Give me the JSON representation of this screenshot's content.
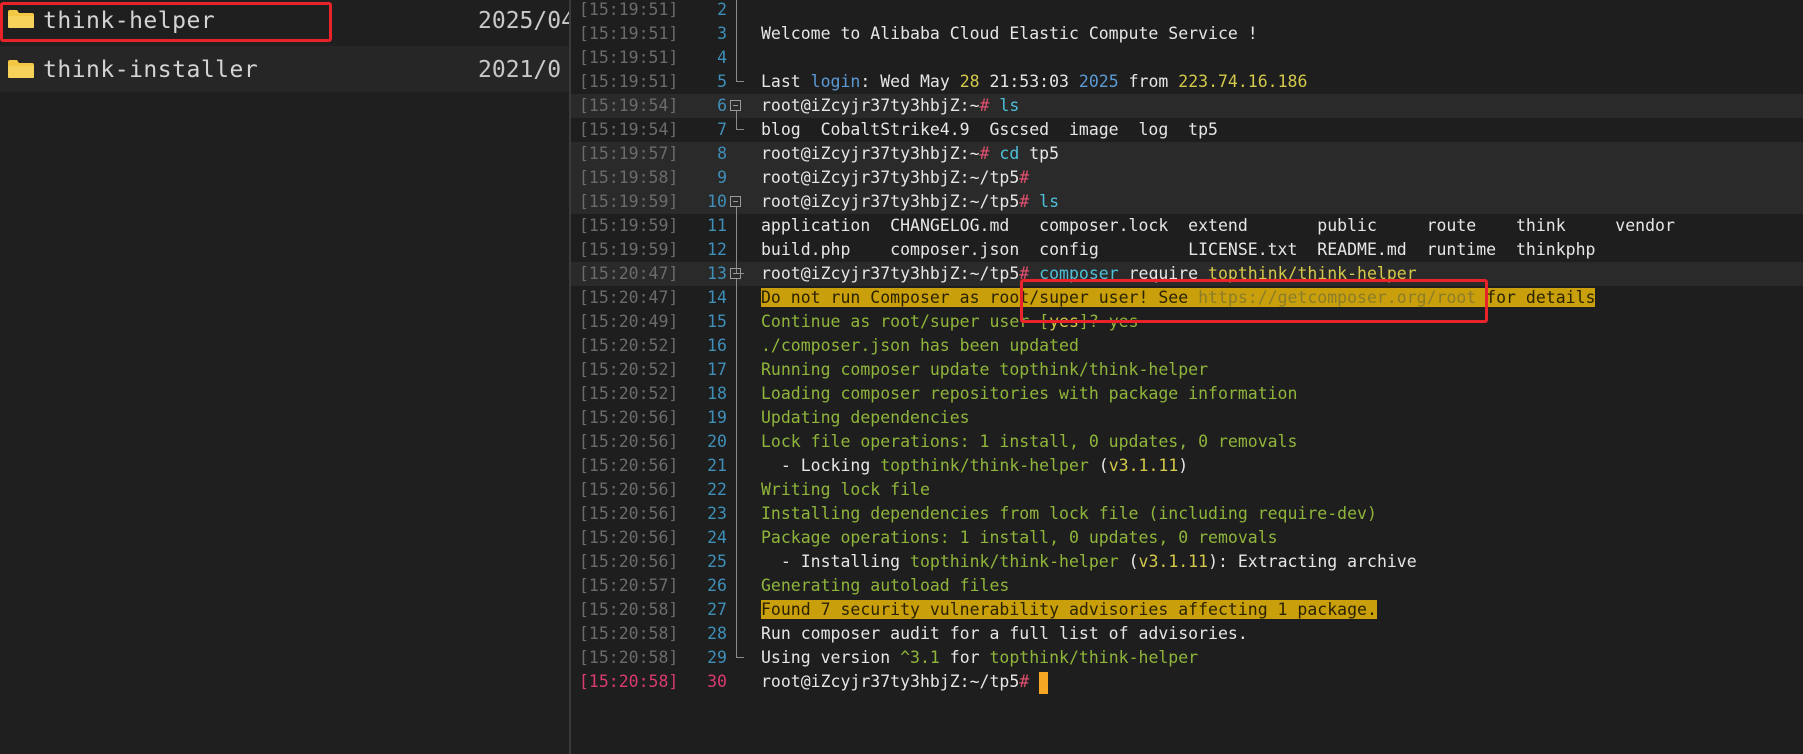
{
  "files": [
    {
      "name": "think-helper",
      "date": "2025/04"
    },
    {
      "name": "think-installer",
      "date": "2021/0"
    }
  ],
  "terminal": {
    "lines": [
      {
        "ts": "[15:19:51]",
        "ln": "2",
        "segs": []
      },
      {
        "ts": "[15:19:51]",
        "ln": "3",
        "segs": [
          {
            "t": "Welcome to Alibaba Cloud Elastic Compute Service !",
            "c": "w"
          }
        ]
      },
      {
        "ts": "[15:19:51]",
        "ln": "4",
        "segs": []
      },
      {
        "ts": "[15:19:51]",
        "ln": "5",
        "segs": [
          {
            "t": "Last ",
            "c": "w"
          },
          {
            "t": "login",
            "c": "b"
          },
          {
            "t": ": Wed May ",
            "c": "w"
          },
          {
            "t": "28",
            "c": "y"
          },
          {
            "t": " 21:53:03 ",
            "c": "w"
          },
          {
            "t": "2025",
            "c": "b"
          },
          {
            "t": " from ",
            "c": "w"
          },
          {
            "t": "223.74.16.186",
            "c": "y"
          }
        ]
      },
      {
        "ts": "[15:19:54]",
        "ln": "6",
        "segs": [
          {
            "t": "root@iZcyjr37ty3hbjZ:~",
            "c": "w"
          },
          {
            "t": "# ",
            "c": "r"
          },
          {
            "t": "ls",
            "c": "c"
          }
        ]
      },
      {
        "ts": "[15:19:54]",
        "ln": "7",
        "segs": [
          {
            "t": "blog  CobaltStrike4.9  Gscsed  image  log  tp5",
            "c": "w"
          }
        ]
      },
      {
        "ts": "[15:19:57]",
        "ln": "8",
        "segs": [
          {
            "t": "root@iZcyjr37ty3hbjZ:~",
            "c": "w"
          },
          {
            "t": "# ",
            "c": "r"
          },
          {
            "t": "cd",
            "c": "c"
          },
          {
            "t": " tp5",
            "c": "w"
          }
        ]
      },
      {
        "ts": "[15:19:58]",
        "ln": "9",
        "segs": [
          {
            "t": "root@iZcyjr37ty3hbjZ:~/tp5",
            "c": "w"
          },
          {
            "t": "#",
            "c": "r"
          }
        ]
      },
      {
        "ts": "[15:19:59]",
        "ln": "10",
        "segs": [
          {
            "t": "root@iZcyjr37ty3hbjZ:~/tp5",
            "c": "w"
          },
          {
            "t": "# ",
            "c": "r"
          },
          {
            "t": "ls",
            "c": "c"
          }
        ]
      },
      {
        "ts": "[15:19:59]",
        "ln": "11",
        "segs": [
          {
            "t": "application  CHANGELOG.md   composer.lock  extend       public     route    think     vendor",
            "c": "w"
          }
        ]
      },
      {
        "ts": "[15:19:59]",
        "ln": "12",
        "segs": [
          {
            "t": "build.php    composer.json  config         LICENSE.txt  README.md  runtime  thinkphp",
            "c": "w"
          }
        ]
      },
      {
        "ts": "[15:20:47]",
        "ln": "13",
        "segs": [
          {
            "t": "root@iZcyjr37ty3hbjZ:~/tp5",
            "c": "w"
          },
          {
            "t": "# ",
            "c": "r"
          },
          {
            "t": "composer",
            "c": "c"
          },
          {
            "t": " require ",
            "c": "w"
          },
          {
            "t": "topthink/think-helper",
            "c": "y"
          }
        ]
      },
      {
        "ts": "[15:20:47]",
        "ln": "14",
        "segs": [
          {
            "t": "Do not run Composer as root/super user! See ",
            "c": "warn"
          },
          {
            "t": "https://getcomposer.org/root",
            "c": "warndim"
          },
          {
            "t": " for details",
            "c": "warn"
          }
        ]
      },
      {
        "ts": "[15:20:49]",
        "ln": "15",
        "segs": [
          {
            "t": "Continue as root/super user [",
            "c": "g"
          },
          {
            "t": "yes",
            "c": "y"
          },
          {
            "t": "]? ",
            "c": "g"
          },
          {
            "t": "yes",
            "c": "g"
          }
        ]
      },
      {
        "ts": "[15:20:52]",
        "ln": "16",
        "segs": [
          {
            "t": "./composer.json has been updated",
            "c": "g"
          }
        ]
      },
      {
        "ts": "[15:20:52]",
        "ln": "17",
        "segs": [
          {
            "t": "Running composer update topthink/think-helper",
            "c": "g"
          }
        ]
      },
      {
        "ts": "[15:20:52]",
        "ln": "18",
        "segs": [
          {
            "t": "Loading composer repositories with package information",
            "c": "g"
          }
        ]
      },
      {
        "ts": "[15:20:56]",
        "ln": "19",
        "segs": [
          {
            "t": "Updating dependencies",
            "c": "g"
          }
        ]
      },
      {
        "ts": "[15:20:56]",
        "ln": "20",
        "segs": [
          {
            "t": "Lock file operations: 1 install, 0 updates, 0 removals",
            "c": "g"
          }
        ]
      },
      {
        "ts": "[15:20:56]",
        "ln": "21",
        "segs": [
          {
            "t": "  - Locking ",
            "c": "w"
          },
          {
            "t": "topthink/think-helper",
            "c": "g"
          },
          {
            "t": " (",
            "c": "w"
          },
          {
            "t": "v3.1.11",
            "c": "y"
          },
          {
            "t": ")",
            "c": "w"
          }
        ]
      },
      {
        "ts": "[15:20:56]",
        "ln": "22",
        "segs": [
          {
            "t": "Writing lock file",
            "c": "g"
          }
        ]
      },
      {
        "ts": "[15:20:56]",
        "ln": "23",
        "segs": [
          {
            "t": "Installing dependencies from lock file (including require-dev)",
            "c": "g"
          }
        ]
      },
      {
        "ts": "[15:20:56]",
        "ln": "24",
        "segs": [
          {
            "t": "Package operations: 1 install, 0 updates, 0 removals",
            "c": "g"
          }
        ]
      },
      {
        "ts": "[15:20:56]",
        "ln": "25",
        "segs": [
          {
            "t": "  - Installing ",
            "c": "w"
          },
          {
            "t": "topthink/think-helper",
            "c": "g"
          },
          {
            "t": " (",
            "c": "w"
          },
          {
            "t": "v3.1.11",
            "c": "y"
          },
          {
            "t": "): Extracting archive",
            "c": "w"
          }
        ]
      },
      {
        "ts": "[15:20:57]",
        "ln": "26",
        "segs": [
          {
            "t": "Generating autoload files",
            "c": "g"
          }
        ]
      },
      {
        "ts": "[15:20:58]",
        "ln": "27",
        "segs": [
          {
            "t": "Found 7 security vulnerability advisories affecting 1 package.",
            "c": "warn"
          }
        ]
      },
      {
        "ts": "[15:20:58]",
        "ln": "28",
        "segs": [
          {
            "t": "Run composer audit for a full list of advisories.",
            "c": "w"
          }
        ]
      },
      {
        "ts": "[15:20:58]",
        "ln": "29",
        "segs": [
          {
            "t": "Using version ",
            "c": "w"
          },
          {
            "t": "^3.1",
            "c": "g"
          },
          {
            "t": " for ",
            "c": "w"
          },
          {
            "t": "topthink/think-helper",
            "c": "g"
          }
        ]
      },
      {
        "ts": "[15:20:58]",
        "ln": "30",
        "segs": [
          {
            "t": "root@iZcyjr37ty3hbjZ:~/tp5",
            "c": "w"
          },
          {
            "t": "# ",
            "c": "r"
          }
        ]
      }
    ]
  }
}
